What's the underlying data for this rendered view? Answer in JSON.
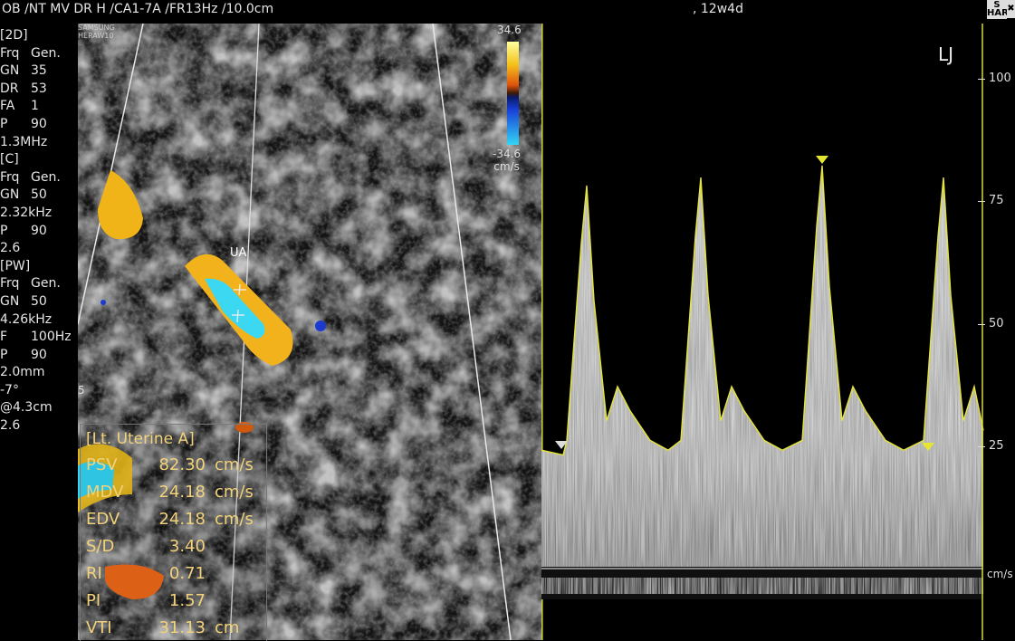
{
  "header": {
    "left_text": "OB /NT MV DR H /CA1-7A /FR13Hz /10.0cm",
    "right_text": ", 12w4d",
    "btn_s_top": "S",
    "btn_s_bottom": "HAR",
    "btn_x": "✖"
  },
  "params": [
    {
      "k": "[2D]",
      "v": ""
    },
    {
      "k": "Frq",
      "v": "Gen."
    },
    {
      "k": "GN",
      "v": "35"
    },
    {
      "k": "DR",
      "v": "53"
    },
    {
      "k": "FA",
      "v": "1"
    },
    {
      "k": "P",
      "v": "90"
    },
    {
      "k": "1.3MHz",
      "v": ""
    },
    {
      "k": "[C]",
      "v": ""
    },
    {
      "k": "Frq",
      "v": "Gen."
    },
    {
      "k": "GN",
      "v": "50"
    },
    {
      "k": "2.32kHz",
      "v": ""
    },
    {
      "k": "P",
      "v": "90"
    },
    {
      "k": "2.6",
      "v": ""
    },
    {
      "k": "[PW]",
      "v": ""
    },
    {
      "k": "Frq",
      "v": "Gen."
    },
    {
      "k": "GN",
      "v": "50"
    },
    {
      "k": "4.26kHz",
      "v": ""
    },
    {
      "k": "F",
      "v": "100Hz"
    },
    {
      "k": "P",
      "v": "90"
    },
    {
      "k": " 2.0mm",
      "v": ""
    },
    {
      "k": " -7°",
      "v": ""
    },
    {
      "k": "@4.3cm",
      "v": ""
    },
    {
      "k": "2.6",
      "v": ""
    }
  ],
  "bmode": {
    "brand_line1": "SAMSUNG",
    "brand_line2": "HERAW10",
    "vessel_label": "UA",
    "depth_mark": "5",
    "color_scale_max": "34.6",
    "color_scale_min": "-34.6",
    "color_scale_unit": "cm/s"
  },
  "measurements": {
    "title": "[Lt. Uterine A]",
    "rows": [
      {
        "label": "PSV",
        "value": "82.30",
        "unit": "cm/s"
      },
      {
        "label": "MDV",
        "value": "24.18",
        "unit": "cm/s"
      },
      {
        "label": "EDV",
        "value": "24.18",
        "unit": "cm/s"
      },
      {
        "label": "S/D",
        "value": "3.40",
        "unit": ""
      },
      {
        "label": "RI",
        "value": "0.71",
        "unit": ""
      },
      {
        "label": "PI",
        "value": "1.57",
        "unit": ""
      },
      {
        "label": "VTI",
        "value": "31.13",
        "unit": "cm"
      }
    ]
  },
  "doppler": {
    "corner_label": "LJ",
    "velocity_unit": "cm/s",
    "scale_ticks": [
      "100",
      "75",
      "50",
      "25"
    ],
    "psv_cm_s": 82.3,
    "edv_cm_s": 24.18
  },
  "colors": {
    "trace_yellow": "#e6e632",
    "flow_yellow": "#f4c21a",
    "flow_cyan": "#33d5f5",
    "measure_text": "#f2d27a"
  }
}
